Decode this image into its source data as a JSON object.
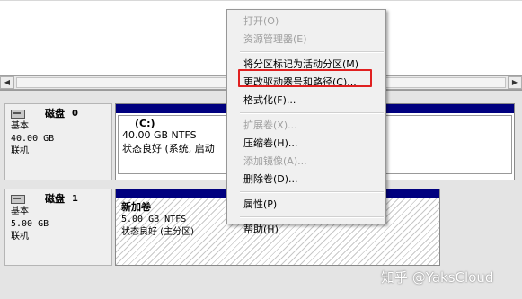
{
  "disks": [
    {
      "name": "磁盘",
      "number": "0",
      "type": "基本",
      "size": "40.00 GB",
      "status": "联机",
      "volume": {
        "name": "(C:)",
        "size_fs": "40.00 GB NTFS",
        "status": "状态良好 (系统, 启动"
      }
    },
    {
      "name": "磁盘",
      "number": "1",
      "type": "基本",
      "size": "5.00 GB",
      "status": "联机",
      "volume": {
        "name": "新加卷",
        "size_fs": "5.00 GB NTFS",
        "status": "状态良好 (主分区)"
      }
    }
  ],
  "context_menu": {
    "items": [
      {
        "label": "打开(O)",
        "enabled": false
      },
      {
        "label": "资源管理器(E)",
        "enabled": false
      },
      {
        "label": "将分区标记为活动分区(M)",
        "enabled": true
      },
      {
        "label": "更改驱动器号和路径(C)...",
        "enabled": true
      },
      {
        "label": "格式化(F)...",
        "enabled": true
      },
      {
        "label": "扩展卷(X)...",
        "enabled": false
      },
      {
        "label": "压缩卷(H)...",
        "enabled": true
      },
      {
        "label": "添加镜像(A)...",
        "enabled": false
      },
      {
        "label": "删除卷(D)...",
        "enabled": true
      },
      {
        "label": "属性(P)",
        "enabled": true
      },
      {
        "label": "帮助(H)",
        "enabled": true
      }
    ]
  },
  "colors": {
    "volume_header": "#00007f",
    "highlight_box": "#e02020"
  },
  "watermark": "知乎 @YaksCloud"
}
